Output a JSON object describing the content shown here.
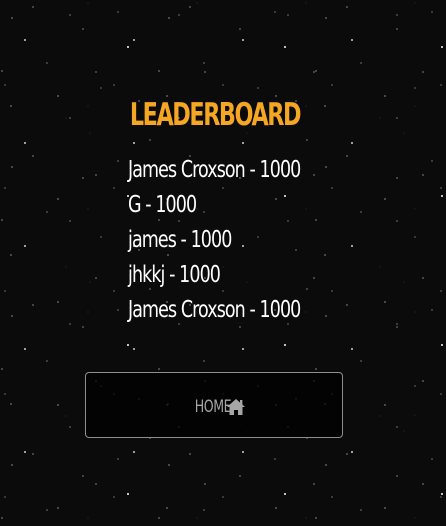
{
  "screen": {
    "title": "LEADERBOARD",
    "title_color": "#f5a623",
    "background_color": "#0b0b0b"
  },
  "leaderboard": {
    "entries": [
      "James Croxson - 1000",
      "G - 1000",
      "james - 1000",
      "jhkkj - 1000",
      "James Croxson - 1000"
    ]
  },
  "home_button": {
    "label": "HOME",
    "icon": "home-icon",
    "text_color": "#a6a6a6",
    "border_color": "#8e8e8e"
  }
}
